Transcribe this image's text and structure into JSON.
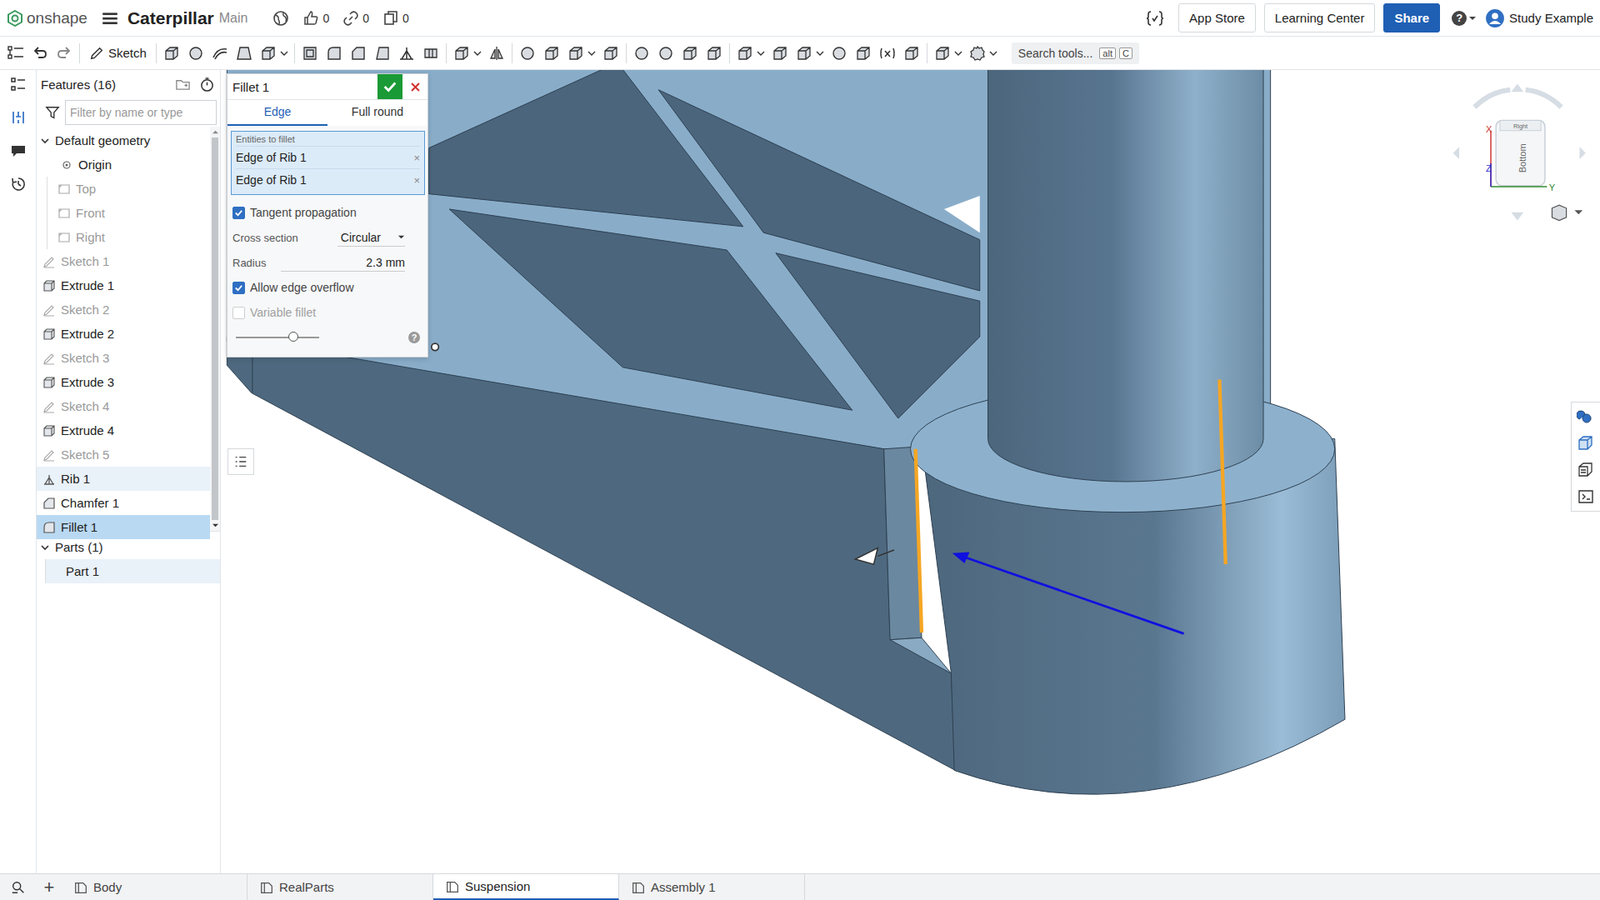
{
  "topbar": {
    "logo": "onshape",
    "document": "Caterpillar",
    "branch": "Main",
    "counters": [
      {
        "kind": "like",
        "count": "0"
      },
      {
        "kind": "link",
        "count": "0"
      },
      {
        "kind": "copy",
        "count": "0"
      }
    ],
    "buttons": [
      {
        "label": "App Store",
        "primary": false
      },
      {
        "label": "Learning Center",
        "primary": false
      },
      {
        "label": "Share",
        "primary": true
      }
    ],
    "help": "?",
    "user": "Study Example"
  },
  "toolbar": {
    "sketch": "Sketch",
    "search": {
      "placeholder": "Search tools...",
      "keys": [
        "alt",
        "C"
      ]
    }
  },
  "features": {
    "title": "Features (16)",
    "filter_placeholder": "Filter by name or type",
    "items": [
      {
        "label": "Default geometry",
        "kind": "group",
        "expanded": true,
        "hidden": false,
        "highlighted": false,
        "selected": false
      },
      {
        "label": "Origin",
        "kind": "origin",
        "expanded": false,
        "hidden": false,
        "highlighted": false,
        "selected": false
      },
      {
        "label": "Top",
        "kind": "plane",
        "expanded": false,
        "hidden": true,
        "highlighted": false,
        "selected": false
      },
      {
        "label": "Front",
        "kind": "plane",
        "expanded": false,
        "hidden": true,
        "highlighted": false,
        "selected": false
      },
      {
        "label": "Right",
        "kind": "plane",
        "expanded": false,
        "hidden": true,
        "highlighted": false,
        "selected": false
      },
      {
        "label": "Sketch 1",
        "kind": "sketch",
        "expanded": false,
        "hidden": true,
        "highlighted": false,
        "selected": false
      },
      {
        "label": "Extrude 1",
        "kind": "extrude",
        "expanded": false,
        "hidden": false,
        "highlighted": false,
        "selected": false
      },
      {
        "label": "Sketch 2",
        "kind": "sketch",
        "expanded": false,
        "hidden": true,
        "highlighted": false,
        "selected": false
      },
      {
        "label": "Extrude 2",
        "kind": "extrude",
        "expanded": false,
        "hidden": false,
        "highlighted": false,
        "selected": false
      },
      {
        "label": "Sketch 3",
        "kind": "sketch",
        "expanded": false,
        "hidden": true,
        "highlighted": false,
        "selected": false
      },
      {
        "label": "Extrude 3",
        "kind": "extrude",
        "expanded": false,
        "hidden": false,
        "highlighted": false,
        "selected": false
      },
      {
        "label": "Sketch 4",
        "kind": "sketch",
        "expanded": false,
        "hidden": true,
        "highlighted": false,
        "selected": false
      },
      {
        "label": "Extrude 4",
        "kind": "extrude",
        "expanded": false,
        "hidden": false,
        "highlighted": false,
        "selected": false
      },
      {
        "label": "Sketch 5",
        "kind": "sketch",
        "expanded": false,
        "hidden": true,
        "highlighted": false,
        "selected": false
      },
      {
        "label": "Rib 1",
        "kind": "rib",
        "expanded": false,
        "hidden": false,
        "highlighted": true,
        "selected": false
      },
      {
        "label": "Chamfer 1",
        "kind": "chamfer",
        "expanded": false,
        "hidden": false,
        "highlighted": false,
        "selected": false
      },
      {
        "label": "Fillet 1",
        "kind": "fillet",
        "expanded": false,
        "hidden": false,
        "highlighted": false,
        "selected": true
      }
    ],
    "parts": {
      "title": "Parts (1)",
      "expanded": true,
      "items": [
        {
          "label": "Part 1",
          "highlighted": true,
          "selected": false
        }
      ]
    }
  },
  "dialog": {
    "title": "Fillet 1",
    "tabs": [
      {
        "label": "Edge",
        "selected": true
      },
      {
        "label": "Full round",
        "selected": false
      }
    ],
    "entities_label": "Entities to fillet",
    "entities": [
      "Edge of Rib 1",
      "Edge of Rib 1"
    ],
    "remove_glyph": "×",
    "options": [
      {
        "kind": "checkbox",
        "label": "Tangent propagation",
        "checked": true,
        "disabled": false
      },
      {
        "kind": "select",
        "label": "Cross section",
        "value": "Circular"
      },
      {
        "kind": "number",
        "label": "Radius",
        "value": "2.3 mm"
      },
      {
        "kind": "checkbox",
        "label": "Allow edge overflow",
        "checked": true,
        "disabled": false
      },
      {
        "kind": "checkbox",
        "label": "Variable fillet",
        "checked": false,
        "disabled": true
      },
      {
        "kind": "slider",
        "level": 0.69,
        "help": "?"
      }
    ]
  },
  "viewcube": {
    "face": "Bottom",
    "top": "Right",
    "axes": [
      "X",
      "Z",
      "Y"
    ]
  },
  "bottombar": {
    "add": "+",
    "tabs": [
      {
        "label": "Body",
        "selected": false
      },
      {
        "label": "RealParts",
        "selected": false
      },
      {
        "label": "Suspension",
        "selected": true
      },
      {
        "label": "Assembly 1",
        "selected": false
      }
    ]
  }
}
